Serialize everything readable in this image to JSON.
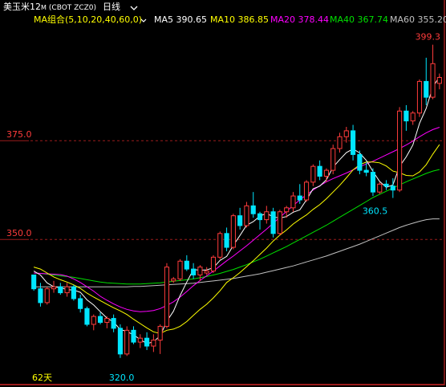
{
  "window": {
    "title": "美玉米12",
    "title_suffix": "M",
    "code": "(CBOT ZCZ0)",
    "period": "日线",
    "period_icon": "chevron-down-icon"
  },
  "ma_bar": {
    "combo_label": "MA组合(5,10,20,40,60,0)",
    "combo_icon": "chevron-down-icon",
    "ma5": "MA5 390.65",
    "ma10": "MA10 386.85",
    "ma20": "MA20 378.44",
    "ma40": "MA40 367.74",
    "ma60": "MA60 355.20"
  },
  "footer": {
    "days_label": "62天"
  },
  "colors": {
    "up": "#ff3c3c",
    "down": "#00e6ff",
    "ma5": "#ffffff",
    "ma10": "#ffff00",
    "ma20": "#ff00ff",
    "ma40": "#00e000",
    "ma60": "#c0c0c0",
    "axis": "#9b1c1c",
    "label": "#ff3c3c",
    "header_text": "#ffff00"
  },
  "chart_data": {
    "type": "candlestick",
    "ylim": [
      316.5,
      403.5
    ],
    "y_ticks": [
      "375.0",
      "350.0"
    ],
    "annotations": {
      "high_label": "399.3",
      "low_label": "360.5",
      "bottom_label": "320.0"
    },
    "candles": [
      [
        341.0,
        341.0,
        337.0,
        337.5
      ],
      [
        337.5,
        339.0,
        333.0,
        334.0
      ],
      [
        334.0,
        338.0,
        333.5,
        337.5
      ],
      [
        337.5,
        339.5,
        336.5,
        338.0
      ],
      [
        338.0,
        339.0,
        336.0,
        336.5
      ],
      [
        336.5,
        339.0,
        335.5,
        338.0
      ],
      [
        338.0,
        338.5,
        334.5,
        335.0
      ],
      [
        335.0,
        336.0,
        331.5,
        332.5
      ],
      [
        332.5,
        333.0,
        328.0,
        328.5
      ],
      [
        328.5,
        331.0,
        327.0,
        330.5
      ],
      [
        330.5,
        331.5,
        328.5,
        329.0
      ],
      [
        329.0,
        330.5,
        327.5,
        330.0
      ],
      [
        330.0,
        331.0,
        326.5,
        327.5
      ],
      [
        327.5,
        328.5,
        320.0,
        321.0
      ],
      [
        321.0,
        328.0,
        320.5,
        327.0
      ],
      [
        327.0,
        328.0,
        323.5,
        324.0
      ],
      [
        324.0,
        326.0,
        322.5,
        325.0
      ],
      [
        325.0,
        326.5,
        322.0,
        323.0
      ],
      [
        323.0,
        326.0,
        321.5,
        324.5
      ],
      [
        324.5,
        328.5,
        321.0,
        328.0
      ],
      [
        328.0,
        344.0,
        327.5,
        343.0
      ],
      [
        339.5,
        340.5,
        339.0,
        340.0
      ],
      [
        340.0,
        345.0,
        339.5,
        344.5
      ],
      [
        344.5,
        346.0,
        342.0,
        342.5
      ],
      [
        342.5,
        344.0,
        340.0,
        341.0
      ],
      [
        341.0,
        343.5,
        339.5,
        343.0
      ],
      [
        341.5,
        343.0,
        341.0,
        342.0
      ],
      [
        342.0,
        346.0,
        341.5,
        345.5
      ],
      [
        345.5,
        352.0,
        345.0,
        351.5
      ],
      [
        351.5,
        353.0,
        347.0,
        348.0
      ],
      [
        348.0,
        356.5,
        347.5,
        356.0
      ],
      [
        356.0,
        358.0,
        352.5,
        353.5
      ],
      [
        353.5,
        359.5,
        353.0,
        358.5
      ],
      [
        358.5,
        362.0,
        355.5,
        356.5
      ],
      [
        356.5,
        357.0,
        352.5,
        355.0
      ],
      [
        355.0,
        358.5,
        354.0,
        357.0
      ],
      [
        357.0,
        358.0,
        350.5,
        351.5
      ],
      [
        351.5,
        357.5,
        351.0,
        357.0
      ],
      [
        357.0,
        358.5,
        355.5,
        358.0
      ],
      [
        358.0,
        362.0,
        357.0,
        361.0
      ],
      [
        361.0,
        364.0,
        359.0,
        360.0
      ],
      [
        360.0,
        365.0,
        359.5,
        364.5
      ],
      [
        364.5,
        369.0,
        363.5,
        368.5
      ],
      [
        368.5,
        370.0,
        365.0,
        366.0
      ],
      [
        366.0,
        368.0,
        364.5,
        367.5
      ],
      [
        367.5,
        374.0,
        366.5,
        373.0
      ],
      [
        373.0,
        377.0,
        372.0,
        376.0
      ],
      [
        376.0,
        378.5,
        374.5,
        377.5
      ],
      [
        377.5,
        379.0,
        370.0,
        371.5
      ],
      [
        371.5,
        372.5,
        366.5,
        367.5
      ],
      [
        367.5,
        369.5,
        366.0,
        367.0
      ],
      [
        367.0,
        368.0,
        361.0,
        362.0
      ],
      [
        362.0,
        364.5,
        361.5,
        364.0
      ],
      [
        364.0,
        365.0,
        362.5,
        363.5
      ],
      [
        363.5,
        365.5,
        360.5,
        362.5
      ],
      [
        362.5,
        383.5,
        362.0,
        382.5
      ],
      [
        382.5,
        384.0,
        377.5,
        380.0
      ],
      [
        380.0,
        382.5,
        379.0,
        382.0
      ],
      [
        382.0,
        390.5,
        381.0,
        390.0
      ],
      [
        390.0,
        396.0,
        384.0,
        386.0
      ],
      [
        386.0,
        399.3,
        385.5,
        394.5
      ],
      [
        389.5,
        392.0,
        388.0,
        391.0
      ]
    ],
    "series": [
      {
        "name": "MA5",
        "values": [
          342.0,
          341.0,
          339.0,
          338.0,
          337.8,
          337.3,
          337.2,
          336.6,
          334.7,
          333.4,
          331.7,
          330.1,
          329.1,
          327.2,
          326.7,
          325.8,
          324.7,
          323.6,
          324.1,
          325.6,
          329.3,
          331.8,
          335.8,
          339.2,
          342.4,
          342.2,
          342.3,
          342.8,
          344.7,
          345.7,
          348.5,
          351.0,
          353.6,
          354.5,
          355.9,
          356.6,
          355.7,
          355.4,
          355.8,
          356.9,
          357.5,
          360.0,
          362.8,
          363.5,
          365.1,
          368.3,
          370.2,
          372.0,
          372.9,
          371.9,
          370.0,
          367.2,
          364.7,
          363.2,
          363.8,
          368.5,
          370.9,
          373.9,
          379.4,
          383.2,
          388.6,
          391.2
        ]
      },
      {
        "name": "MA10",
        "values": [
          343.0,
          342.5,
          341.5,
          340.5,
          339.8,
          339.2,
          338.5,
          337.6,
          336.4,
          335.4,
          334.5,
          333.6,
          332.7,
          331.9,
          331.0,
          329.8,
          328.7,
          327.6,
          326.6,
          326.2,
          327.0,
          327.3,
          328.0,
          329.2,
          330.8,
          332.3,
          333.6,
          335.2,
          337.0,
          339.1,
          340.3,
          341.6,
          343.1,
          344.6,
          346.2,
          347.8,
          349.6,
          351.1,
          352.4,
          353.9,
          355.1,
          356.2,
          357.6,
          358.8,
          360.3,
          362.0,
          363.7,
          365.6,
          367.6,
          368.9,
          369.6,
          369.6,
          369.4,
          368.6,
          367.3,
          366.9,
          366.2,
          366.1,
          367.1,
          368.9,
          371.6,
          374.0
        ]
      },
      {
        "name": "MA20",
        "values": [
          341.5,
          341.4,
          341.3,
          341.2,
          341.1,
          340.7,
          340.0,
          339.1,
          338.0,
          336.9,
          335.6,
          334.6,
          333.7,
          332.9,
          332.3,
          331.9,
          331.7,
          331.8,
          332.0,
          332.5,
          333.3,
          334.2,
          335.4,
          336.8,
          338.3,
          339.6,
          340.8,
          342.0,
          343.3,
          344.6,
          345.8,
          347.1,
          348.4,
          349.8,
          351.2,
          352.6,
          354.1,
          355.6,
          357.1,
          358.6,
          360.0,
          361.3,
          362.5,
          363.6,
          364.6,
          365.4,
          366.1,
          366.8,
          367.6,
          368.4,
          369.1,
          369.8,
          370.6,
          371.4,
          372.2,
          373.0,
          373.9,
          374.9,
          376.0,
          377.0,
          377.8,
          378.4
        ]
      },
      {
        "name": "MA40",
        "values": [
          341.5,
          341.4,
          341.2,
          341.0,
          340.8,
          340.6,
          340.4,
          340.1,
          339.8,
          339.5,
          339.2,
          339.0,
          338.9,
          338.8,
          338.7,
          338.7,
          338.7,
          338.8,
          338.9,
          339.0,
          339.2,
          339.4,
          339.6,
          339.8,
          340.0,
          340.3,
          340.6,
          341.0,
          341.4,
          341.9,
          342.4,
          343.0,
          343.6,
          344.3,
          345.0,
          345.8,
          346.6,
          347.4,
          348.2,
          349.1,
          350.0,
          350.9,
          351.8,
          352.7,
          353.6,
          354.6,
          355.6,
          356.6,
          357.6,
          358.6,
          359.6,
          360.6,
          361.4,
          362.2,
          363.0,
          363.8,
          364.6,
          365.3,
          366.0,
          366.7,
          367.3,
          367.7
        ]
      },
      {
        "name": "MA60",
        "values": [
          338.0,
          338.0,
          338.0,
          338.0,
          338.0,
          338.0,
          338.0,
          338.0,
          338.0,
          338.0,
          338.0,
          338.0,
          338.0,
          338.0,
          338.0,
          338.1,
          338.1,
          338.2,
          338.3,
          338.4,
          338.5,
          338.6,
          338.7,
          338.8,
          338.9,
          339.1,
          339.3,
          339.5,
          339.7,
          339.9,
          340.1,
          340.4,
          340.7,
          341.0,
          341.3,
          341.7,
          342.1,
          342.5,
          342.9,
          343.3,
          343.8,
          344.3,
          344.8,
          345.3,
          345.8,
          346.4,
          347.0,
          347.6,
          348.2,
          348.8,
          349.5,
          350.2,
          350.9,
          351.6,
          352.3,
          353.0,
          353.6,
          354.1,
          354.6,
          355.0,
          355.2,
          355.2
        ]
      }
    ]
  }
}
